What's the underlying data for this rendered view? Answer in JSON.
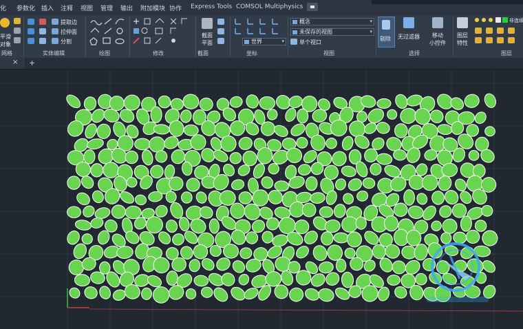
{
  "menu": {
    "items": [
      "化",
      "参数化",
      "插入",
      "注释",
      "视图",
      "管理",
      "输出",
      "附加模块",
      "协作",
      "Express Tools",
      "COMSOL Multiphysics"
    ]
  },
  "ribbon": {
    "panels": {
      "mesh": "网格",
      "solid_edit": "实体编辑",
      "draw": "绘图",
      "modify": "修改",
      "section": "截面",
      "coordinates": "坐标",
      "view": "视图",
      "select": "选择",
      "layers": "图层"
    },
    "mesh_buttons": [
      "平滑",
      "对象"
    ],
    "solid_edit_buttons": [
      "提取边",
      "拉伸面",
      "分割"
    ],
    "section_button": [
      "截面",
      "平面"
    ],
    "ucs_combo": "世界",
    "visual_style_combo": "概念",
    "view_combo": "未保存的视图",
    "viewport_button": "单个视口",
    "cull_button": "剔除",
    "filter_button": "无过滤器",
    "gizmo_button": [
      "移动",
      "小控件"
    ],
    "layer_props_button": [
      "图层",
      "特性"
    ],
    "layer_name": "非连续"
  },
  "drawing": {
    "background": "#212830",
    "cell_fill": "#69d44f",
    "cell_edge": "#ffffff",
    "grid_color": "#3a4654",
    "x_axis_color": "#b44",
    "gizmo_color": "#3fa9f5"
  }
}
